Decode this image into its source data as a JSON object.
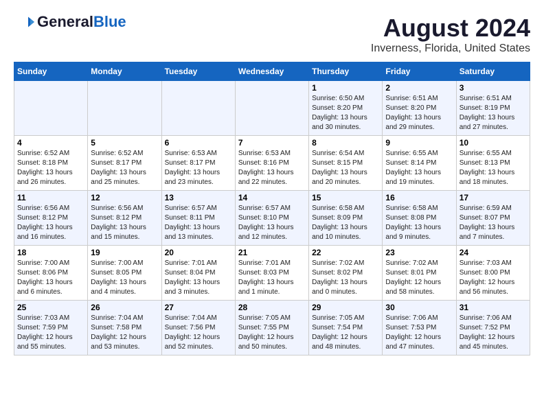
{
  "header": {
    "logo_general": "General",
    "logo_blue": "Blue",
    "title": "August 2024",
    "subtitle": "Inverness, Florida, United States"
  },
  "days_of_week": [
    "Sunday",
    "Monday",
    "Tuesday",
    "Wednesday",
    "Thursday",
    "Friday",
    "Saturday"
  ],
  "weeks": [
    [
      {
        "day": "",
        "info": ""
      },
      {
        "day": "",
        "info": ""
      },
      {
        "day": "",
        "info": ""
      },
      {
        "day": "",
        "info": ""
      },
      {
        "day": "1",
        "info": "Sunrise: 6:50 AM\nSunset: 8:20 PM\nDaylight: 13 hours\nand 30 minutes."
      },
      {
        "day": "2",
        "info": "Sunrise: 6:51 AM\nSunset: 8:20 PM\nDaylight: 13 hours\nand 29 minutes."
      },
      {
        "day": "3",
        "info": "Sunrise: 6:51 AM\nSunset: 8:19 PM\nDaylight: 13 hours\nand 27 minutes."
      }
    ],
    [
      {
        "day": "4",
        "info": "Sunrise: 6:52 AM\nSunset: 8:18 PM\nDaylight: 13 hours\nand 26 minutes."
      },
      {
        "day": "5",
        "info": "Sunrise: 6:52 AM\nSunset: 8:17 PM\nDaylight: 13 hours\nand 25 minutes."
      },
      {
        "day": "6",
        "info": "Sunrise: 6:53 AM\nSunset: 8:17 PM\nDaylight: 13 hours\nand 23 minutes."
      },
      {
        "day": "7",
        "info": "Sunrise: 6:53 AM\nSunset: 8:16 PM\nDaylight: 13 hours\nand 22 minutes."
      },
      {
        "day": "8",
        "info": "Sunrise: 6:54 AM\nSunset: 8:15 PM\nDaylight: 13 hours\nand 20 minutes."
      },
      {
        "day": "9",
        "info": "Sunrise: 6:55 AM\nSunset: 8:14 PM\nDaylight: 13 hours\nand 19 minutes."
      },
      {
        "day": "10",
        "info": "Sunrise: 6:55 AM\nSunset: 8:13 PM\nDaylight: 13 hours\nand 18 minutes."
      }
    ],
    [
      {
        "day": "11",
        "info": "Sunrise: 6:56 AM\nSunset: 8:12 PM\nDaylight: 13 hours\nand 16 minutes."
      },
      {
        "day": "12",
        "info": "Sunrise: 6:56 AM\nSunset: 8:12 PM\nDaylight: 13 hours\nand 15 minutes."
      },
      {
        "day": "13",
        "info": "Sunrise: 6:57 AM\nSunset: 8:11 PM\nDaylight: 13 hours\nand 13 minutes."
      },
      {
        "day": "14",
        "info": "Sunrise: 6:57 AM\nSunset: 8:10 PM\nDaylight: 13 hours\nand 12 minutes."
      },
      {
        "day": "15",
        "info": "Sunrise: 6:58 AM\nSunset: 8:09 PM\nDaylight: 13 hours\nand 10 minutes."
      },
      {
        "day": "16",
        "info": "Sunrise: 6:58 AM\nSunset: 8:08 PM\nDaylight: 13 hours\nand 9 minutes."
      },
      {
        "day": "17",
        "info": "Sunrise: 6:59 AM\nSunset: 8:07 PM\nDaylight: 13 hours\nand 7 minutes."
      }
    ],
    [
      {
        "day": "18",
        "info": "Sunrise: 7:00 AM\nSunset: 8:06 PM\nDaylight: 13 hours\nand 6 minutes."
      },
      {
        "day": "19",
        "info": "Sunrise: 7:00 AM\nSunset: 8:05 PM\nDaylight: 13 hours\nand 4 minutes."
      },
      {
        "day": "20",
        "info": "Sunrise: 7:01 AM\nSunset: 8:04 PM\nDaylight: 13 hours\nand 3 minutes."
      },
      {
        "day": "21",
        "info": "Sunrise: 7:01 AM\nSunset: 8:03 PM\nDaylight: 13 hours\nand 1 minute."
      },
      {
        "day": "22",
        "info": "Sunrise: 7:02 AM\nSunset: 8:02 PM\nDaylight: 13 hours\nand 0 minutes."
      },
      {
        "day": "23",
        "info": "Sunrise: 7:02 AM\nSunset: 8:01 PM\nDaylight: 12 hours\nand 58 minutes."
      },
      {
        "day": "24",
        "info": "Sunrise: 7:03 AM\nSunset: 8:00 PM\nDaylight: 12 hours\nand 56 minutes."
      }
    ],
    [
      {
        "day": "25",
        "info": "Sunrise: 7:03 AM\nSunset: 7:59 PM\nDaylight: 12 hours\nand 55 minutes."
      },
      {
        "day": "26",
        "info": "Sunrise: 7:04 AM\nSunset: 7:58 PM\nDaylight: 12 hours\nand 53 minutes."
      },
      {
        "day": "27",
        "info": "Sunrise: 7:04 AM\nSunset: 7:56 PM\nDaylight: 12 hours\nand 52 minutes."
      },
      {
        "day": "28",
        "info": "Sunrise: 7:05 AM\nSunset: 7:55 PM\nDaylight: 12 hours\nand 50 minutes."
      },
      {
        "day": "29",
        "info": "Sunrise: 7:05 AM\nSunset: 7:54 PM\nDaylight: 12 hours\nand 48 minutes."
      },
      {
        "day": "30",
        "info": "Sunrise: 7:06 AM\nSunset: 7:53 PM\nDaylight: 12 hours\nand 47 minutes."
      },
      {
        "day": "31",
        "info": "Sunrise: 7:06 AM\nSunset: 7:52 PM\nDaylight: 12 hours\nand 45 minutes."
      }
    ]
  ]
}
